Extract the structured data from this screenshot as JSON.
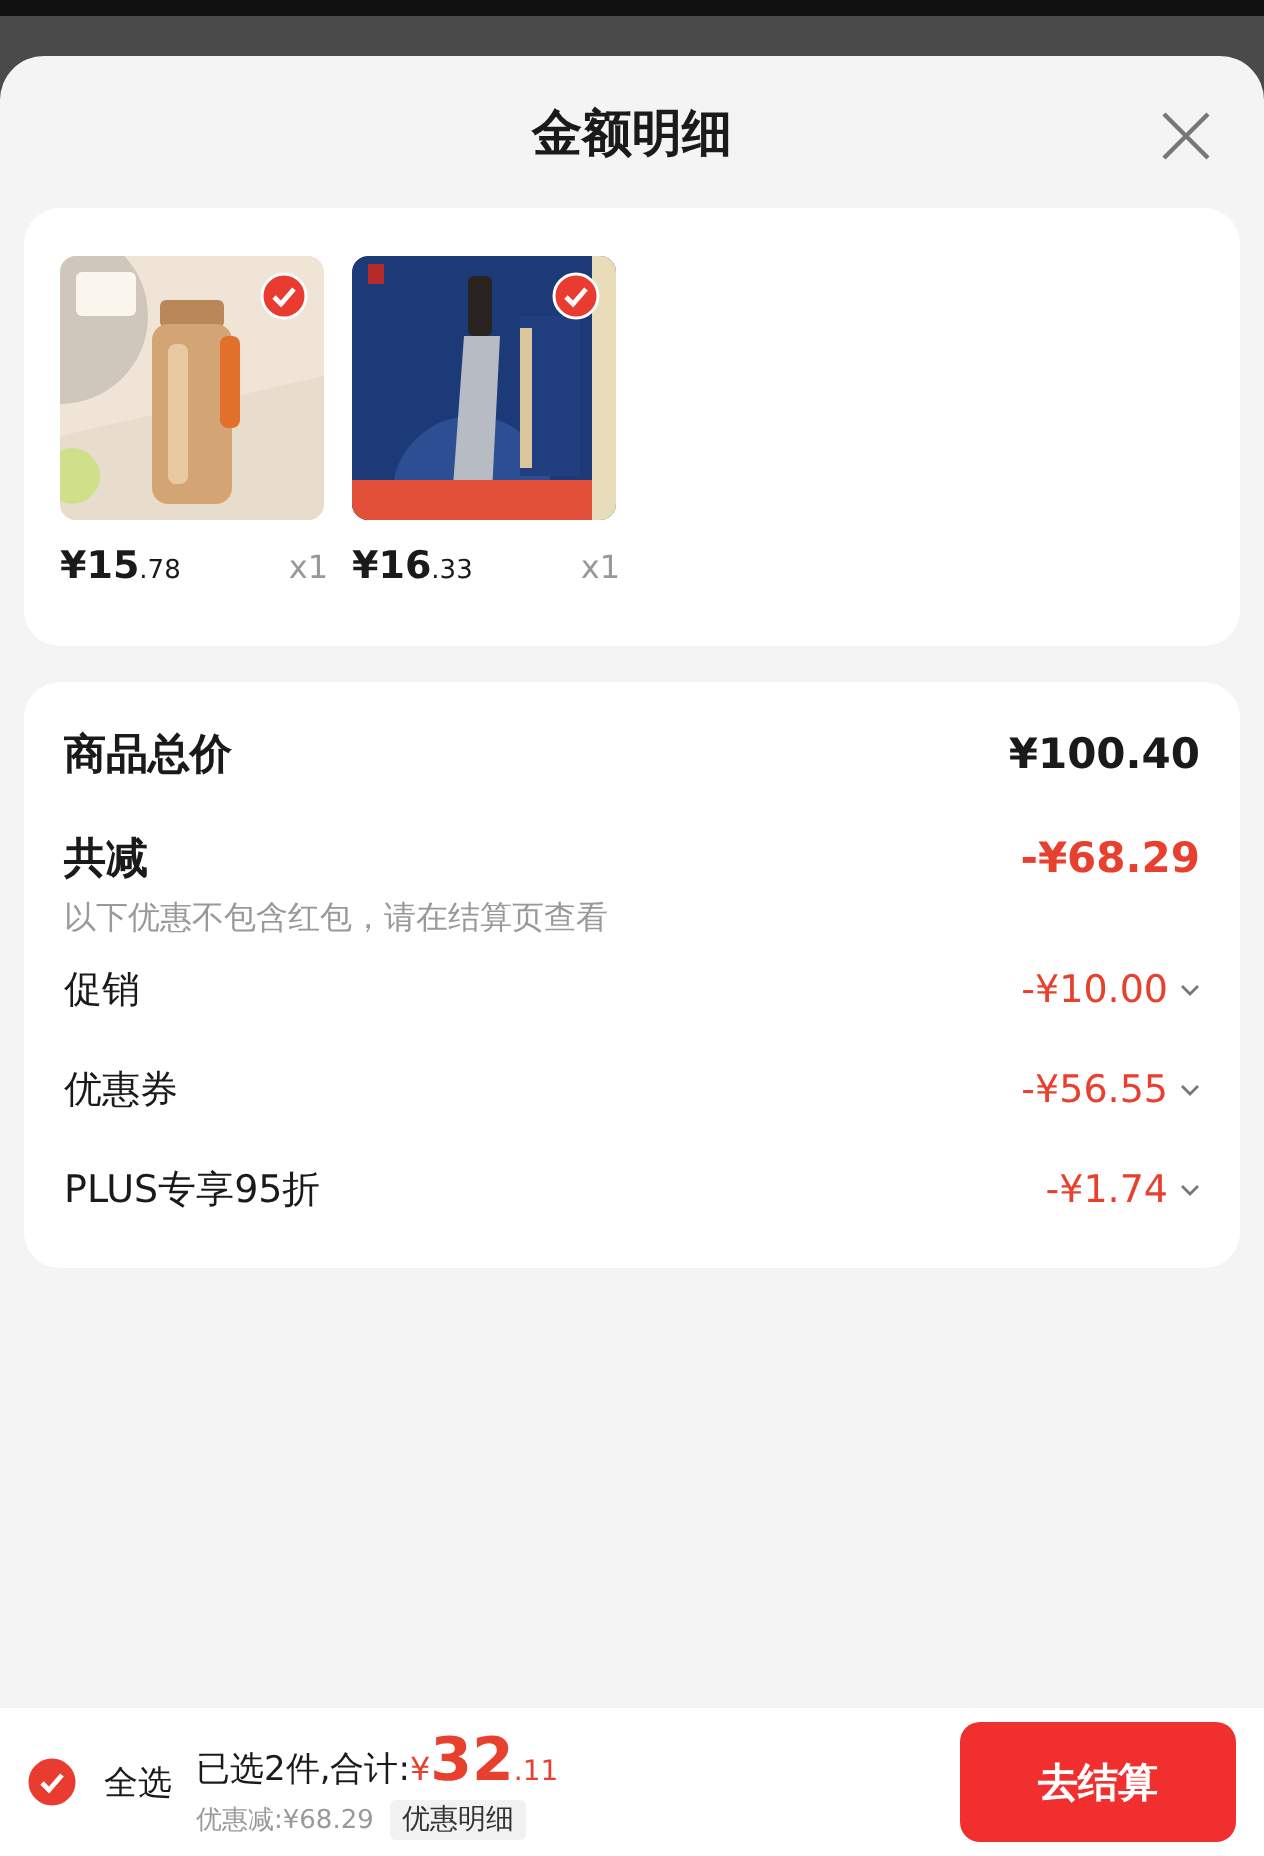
{
  "sheet": {
    "title": "金额明细"
  },
  "products": [
    {
      "kind": "bottle",
      "selected": true,
      "price_main": "¥15",
      "price_decimal": ".78",
      "quantity": "x1"
    },
    {
      "kind": "knife",
      "selected": true,
      "price_main": "¥16",
      "price_decimal": ".33",
      "quantity": "x1"
    }
  ],
  "summary": {
    "total_label": "商品总价",
    "total_value": "¥100.40",
    "discount_label": "共减",
    "discount_value": "-¥68.29",
    "note": "以下优惠不包含红包，请在结算页查看",
    "items": [
      {
        "label": "促销",
        "value": "-¥10.00"
      },
      {
        "label": "优惠券",
        "value": "-¥56.55"
      },
      {
        "label": "PLUS专享95折",
        "value": "-¥1.74"
      }
    ]
  },
  "footer": {
    "select_all": {
      "label": "全选",
      "checked": true
    },
    "selected_text": "已选2件,合计:",
    "currency": "¥",
    "total_main": "32",
    "total_decimal": ".11",
    "saved_text": "优惠减:¥68.29",
    "details_button": "优惠明细",
    "checkout_button": "去结算"
  }
}
